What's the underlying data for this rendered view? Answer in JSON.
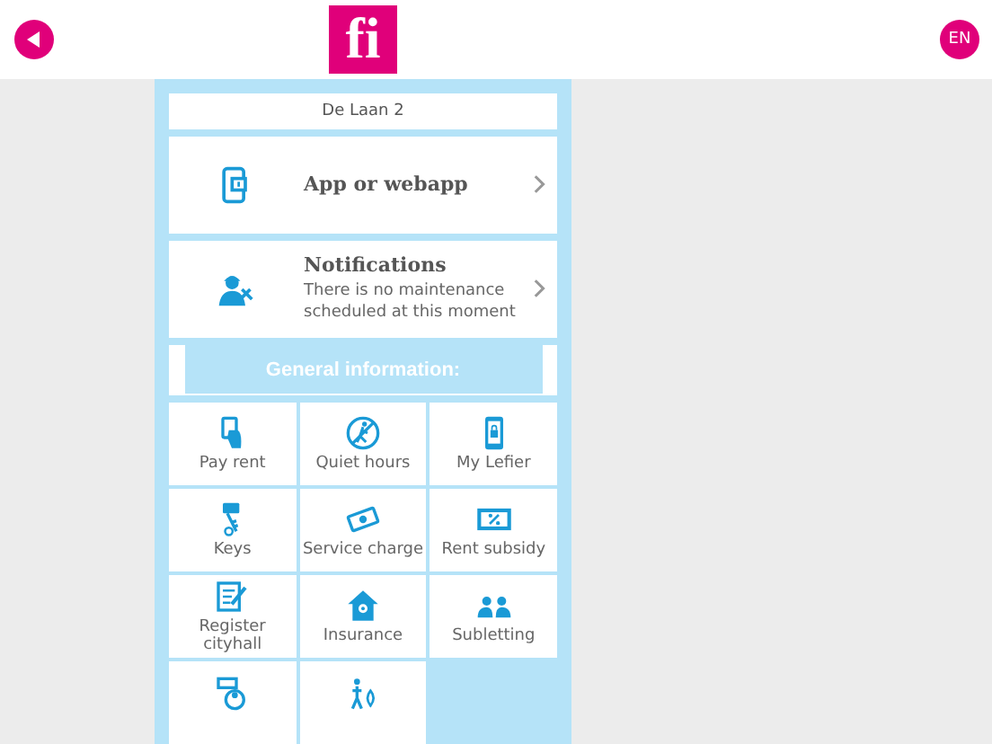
{
  "header": {
    "logo": "fi",
    "language_button": "EN"
  },
  "address": "De Laan 2",
  "cards": [
    {
      "title": "App or webapp"
    },
    {
      "title": "Notifications",
      "subtitle": "There is no maintenance scheduled at this moment"
    }
  ],
  "section_title": "General information:",
  "tiles": [
    {
      "kind": "labelled",
      "label": "Pay rent"
    },
    {
      "kind": "labelled",
      "label": "Quiet hours"
    },
    {
      "kind": "labelled",
      "label": "My Lefier"
    },
    {
      "kind": "labelled",
      "label": "Keys"
    },
    {
      "kind": "labelled",
      "label": "Service charge"
    },
    {
      "kind": "labelled",
      "label": "Rent subsidy"
    },
    {
      "kind": "labelled",
      "label": "Register cityhall"
    },
    {
      "kind": "labelled",
      "label": "Insurance"
    },
    {
      "kind": "labelled",
      "label": "Subletting"
    },
    {
      "kind": "cut"
    },
    {
      "kind": "cut"
    }
  ]
}
